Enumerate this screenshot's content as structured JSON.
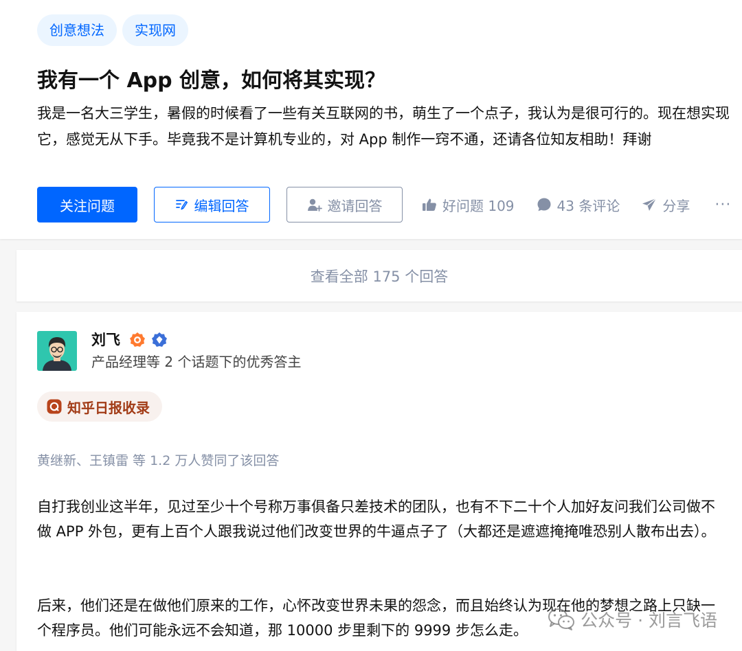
{
  "question": {
    "topics": [
      "创意想法",
      "实现网"
    ],
    "title": "我有一个 App 创意，如何将其实现？",
    "detail": "我是一名大三学生，暑假的时候看了一些有关互联网的书，萌生了一个点子，我认为是很可行的。现在想实现它，感觉无从下手。毕竟我不是计算机专业的，对 App 制作一窍不通，还请各位知友相助！拜谢"
  },
  "actions": {
    "follow_label": "关注问题",
    "edit_answer_label": "编辑回答",
    "invite_label": "邀请回答",
    "good_question_label": "好问题 109",
    "comments_label": "43 条评论",
    "share_label": "分享",
    "more_label": "···"
  },
  "view_all_label": "查看全部 175 个回答",
  "answer": {
    "author_name": "刘飞",
    "author_headline": "产品经理等 2 个话题下的优秀答主",
    "daily_tag": "知乎日报收录",
    "voters_text": "黄继新、王镇雷 等 1.2 万人赞同了该回答",
    "paragraphs": [
      "自打我创业这半年，见过至少十个号称万事俱备只差技术的团队，也有不下二十个人加好友问我们公司做不做 APP 外包，更有上百个人跟我说过他们改变世界的牛逼点子了（大都还是遮遮掩掩唯恐别人散布出去）。",
      "后来，他们还是在做他们原来的工作，心怀改变世界未果的怨念，而且始终认为现在他的梦想之路上只缺一个程序员。他们可能永远不会知道，那 10000 步里剩下的 9999 步怎么走。"
    ]
  },
  "watermark": "公众号 · 刘言飞语",
  "colors": {
    "brand_blue": "#0066ff",
    "tag_bg": "#ebf5ff",
    "meta_gray": "#8590a6",
    "daily_tag_bg": "#f8f1ee",
    "daily_tag_text": "#a23c17"
  }
}
